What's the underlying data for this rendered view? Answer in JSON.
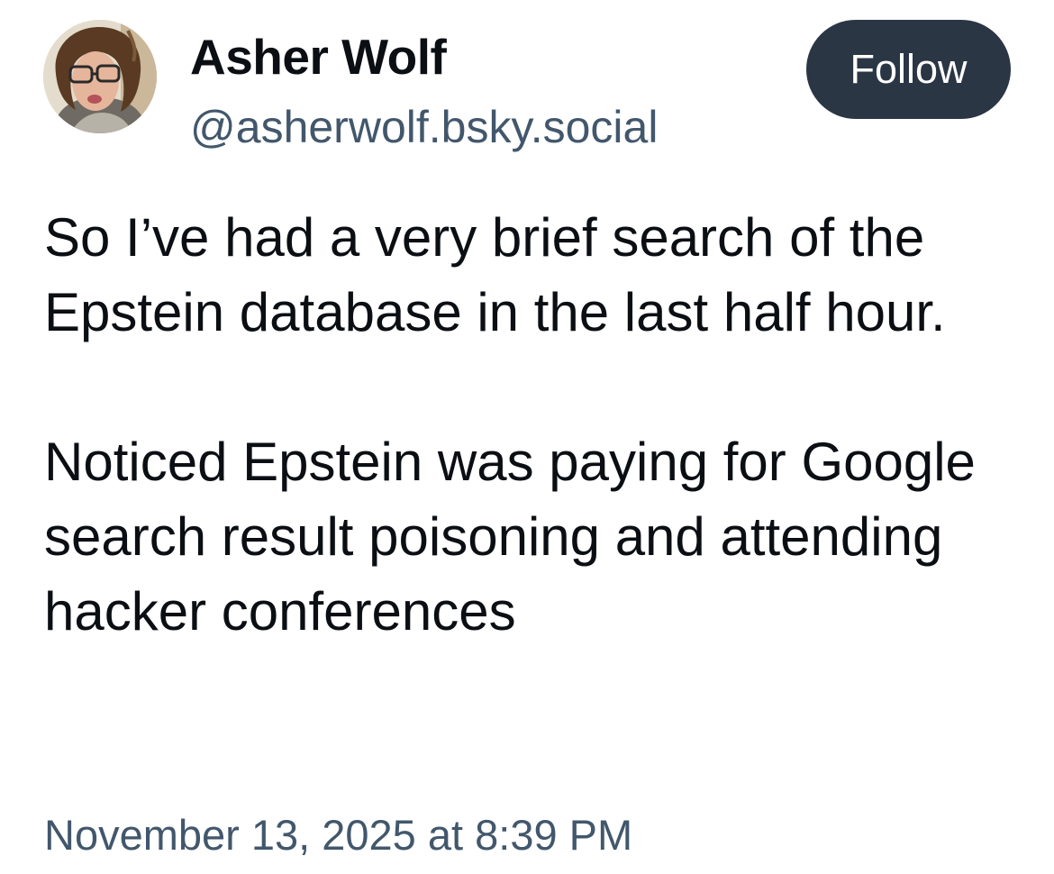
{
  "author": {
    "display_name": "Asher Wolf",
    "handle": "@asherwolf.bsky.social"
  },
  "actions": {
    "follow_label": "Follow"
  },
  "post": {
    "paragraphs": [
      "So I’ve had a very brief search of the Epstein database in the last half hour.",
      "Noticed Epstein was paying for Google search result poisoning and attending hacker conferences"
    ],
    "timestamp": "November 13, 2025 at 8:39 PM"
  },
  "colors": {
    "text_primary": "#0b0f14",
    "text_secondary": "#42576c",
    "button_background": "#2b3645",
    "button_text": "#ffffff",
    "background": "#ffffff"
  }
}
